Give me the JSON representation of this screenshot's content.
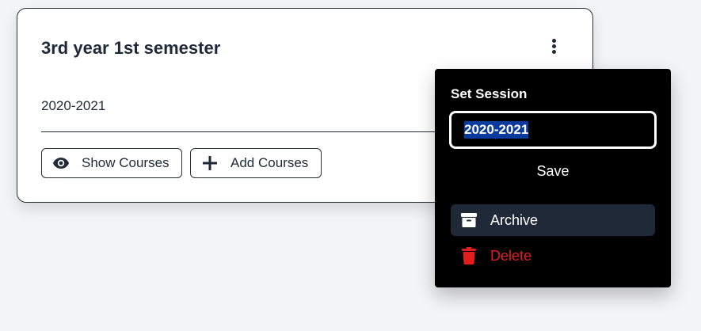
{
  "card": {
    "title": "3rd year 1st semester",
    "session": "2020-2021",
    "show_courses_label": "Show Courses",
    "add_courses_label": "Add Courses"
  },
  "menu": {
    "heading": "Set Session",
    "session_value": "2020-2021",
    "save_label": "Save",
    "archive_label": "Archive",
    "delete_label": "Delete"
  },
  "icons": {
    "more": "kebab-vertical-icon",
    "show": "eye-icon",
    "add": "plus-icon",
    "archive": "archive-box-icon",
    "delete": "trash-icon"
  },
  "colors": {
    "page_bg": "#f3f4f7",
    "menu_bg": "#000000",
    "archive_bg": "#1f2937",
    "delete_red": "#e11d1d",
    "selection": "#0a3b9c"
  }
}
